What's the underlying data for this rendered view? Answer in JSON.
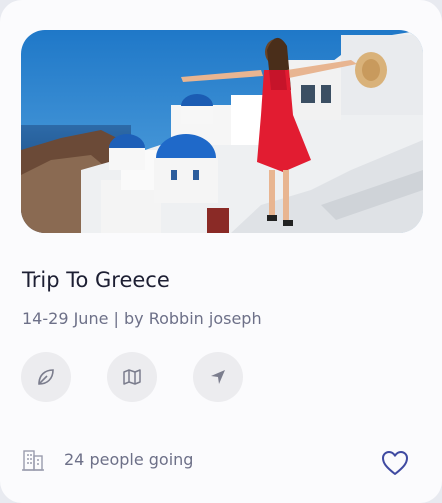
{
  "card": {
    "image_alt": "Woman in red dress with open arms in Santorini",
    "title": "Trip To Greece",
    "subtitle": "14-29 June | by Robbin joseph",
    "actions": [
      {
        "icon": "leaf-icon"
      },
      {
        "icon": "map-icon"
      },
      {
        "icon": "navigation-arrow-icon"
      }
    ],
    "footer": {
      "icon": "building-icon",
      "people_going": "24 people going",
      "favorite_icon": "heart-outline-icon"
    }
  },
  "colors": {
    "card_bg": "#fbfbfd",
    "title": "#1d1f33",
    "muted": "#6d7088",
    "icon_circle_bg": "#ececef",
    "icon_stroke": "#7b7d8d",
    "heart": "#3f4aa1"
  }
}
